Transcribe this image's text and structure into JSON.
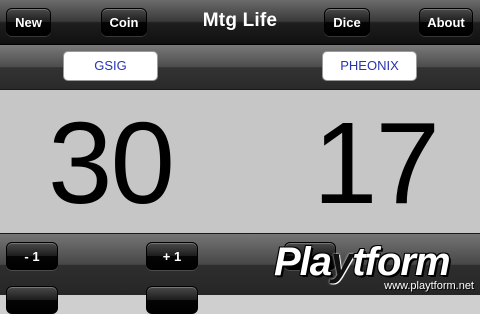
{
  "header": {
    "title": "Mtg Life",
    "buttons": {
      "new": "New",
      "coin": "Coin",
      "dice": "Dice",
      "about": "About"
    }
  },
  "players": [
    {
      "name": "GSIG",
      "life": "30"
    },
    {
      "name": "PHEONIX",
      "life": "17"
    }
  ],
  "controls": {
    "minus_one": "- 1",
    "plus_one": "+ 1"
  },
  "watermark": {
    "brand_pre": "Pla",
    "brand_y": "y",
    "brand_post": "tform",
    "site": "www.playtform.net"
  },
  "colors": {
    "name_text": "#2834b4",
    "life_bg": "#c6c6c6"
  }
}
